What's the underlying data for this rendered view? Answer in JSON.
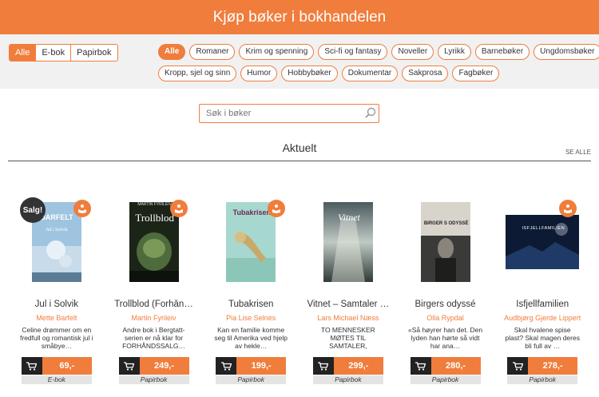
{
  "header": {
    "title": "Kjøp bøker i bokhandelen"
  },
  "format_filter": [
    "Alle",
    "E-bok",
    "Papirbok"
  ],
  "categories": {
    "row1": [
      "Alle",
      "Romaner",
      "Krim og spenning",
      "Sci-fi og fantasy",
      "Noveller",
      "Lyrikk",
      "Barnebøker",
      "Ungdomsbøker"
    ],
    "row2": [
      "Kropp, sjel og sinn",
      "Humor",
      "Hobbybøker",
      "Dokumentar",
      "Sakprosa",
      "Fagbøker"
    ]
  },
  "search": {
    "placeholder": "Søk i bøker"
  },
  "section": {
    "title": "Aktuelt",
    "see_all": "SE ALLE"
  },
  "colors": {
    "accent": "#f07d3c",
    "dark": "#222222"
  },
  "books": [
    {
      "title": "Jul i Solvik",
      "author": "Mette Barfelt",
      "desc": "Celine drømmer om en fredfull og romantisk jul i småbye…",
      "price": "69,-",
      "format": "E-bok",
      "sale": "Salg!"
    },
    {
      "title": "Trollblod (Forhån…",
      "author": "Martin Fyrileiv",
      "desc": "Andre bok i Bergtatt-serien er nå klar for FORHÅNDSSALG…",
      "price": "249,-",
      "format": "Papirbok",
      "cover_text": "Trollblod",
      "cover_author": "MARTIN FYRILEIV"
    },
    {
      "title": "Tubakrisen",
      "author": "Pia Lise Selnes",
      "desc": "Kan en familie komme seg til Amerika ved hjelp av hekle…",
      "price": "199,-",
      "format": "Papirbok",
      "cover_text": "Tubakrisen"
    },
    {
      "title": "Vitnet – Samtaler …",
      "author": "Lars Michael Næss",
      "desc": "TO MENNESKER MØTES TIL SAMTALER, hovedpersonen Lasse To…",
      "price": "299,-",
      "format": "Papirbok",
      "cover_text": "Vitnet"
    },
    {
      "title": "Birgers odyssé",
      "author": "Olla Rypdal",
      "desc": "«Så høyrer han det. Den lyden han hørte så vidt har ana…",
      "price": "280,-",
      "format": "Papirbok",
      "cover_text": "BIRGER S ODYSSÉ"
    },
    {
      "title": "Isfjellfamilien",
      "author": "Audbjørg Gjerde Lippert",
      "desc": "Skal hvalene spise plast? Skal magen deres bli full av …",
      "price": "278,-",
      "format": "Papirbok",
      "cover_text": "ISFJELLFAMILIEN"
    }
  ]
}
